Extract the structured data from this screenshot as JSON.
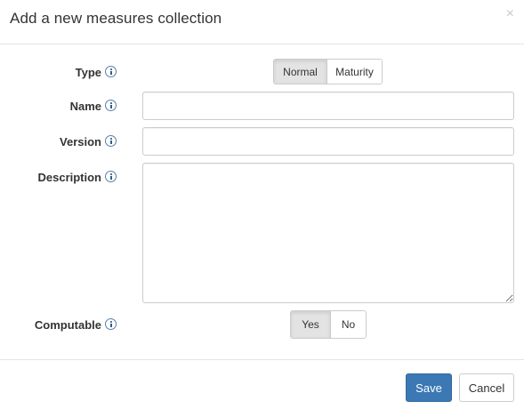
{
  "dialog": {
    "title": "Add a new measures collection",
    "close_glyph": "×"
  },
  "form": {
    "type": {
      "label": "Type",
      "options": [
        "Normal",
        "Maturity"
      ],
      "selected": "Normal"
    },
    "name": {
      "label": "Name",
      "value": ""
    },
    "version": {
      "label": "Version",
      "value": ""
    },
    "description": {
      "label": "Description",
      "value": ""
    },
    "computable": {
      "label": "Computable",
      "options": [
        "Yes",
        "No"
      ],
      "selected": "Yes"
    }
  },
  "footer": {
    "save_label": "Save",
    "cancel_label": "Cancel"
  },
  "colors": {
    "primary": "#3b78b4",
    "info_icon": "#2f5d8c",
    "active_toggle": "#e3e3e3"
  },
  "icons": {
    "info": "info-circle-icon",
    "close": "close-icon"
  }
}
